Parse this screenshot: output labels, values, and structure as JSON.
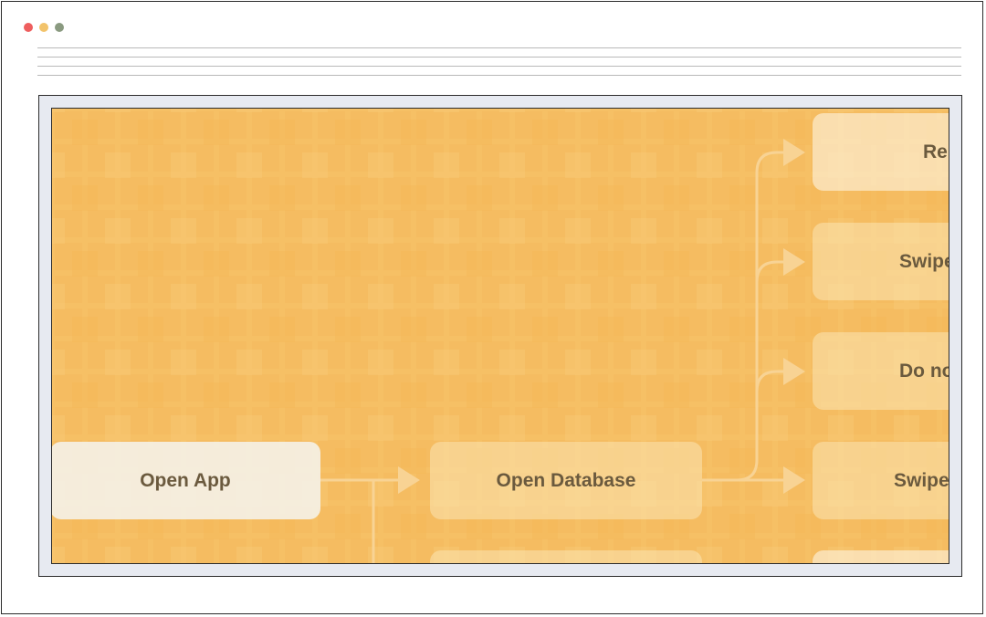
{
  "window": {
    "controls": [
      "close",
      "minimize",
      "zoom"
    ],
    "colors": {
      "close": "#ee5e5e",
      "minimize": "#f2c36b",
      "zoom": "#8a9a80"
    }
  },
  "flowchart": {
    "background_color": "#f6bd5e",
    "nodes": {
      "open_app": "Open App",
      "open_database": "Open Database",
      "right_1": "Re",
      "right_2": "Swipe",
      "right_3": "Do no",
      "right_4": "Swipe"
    }
  }
}
